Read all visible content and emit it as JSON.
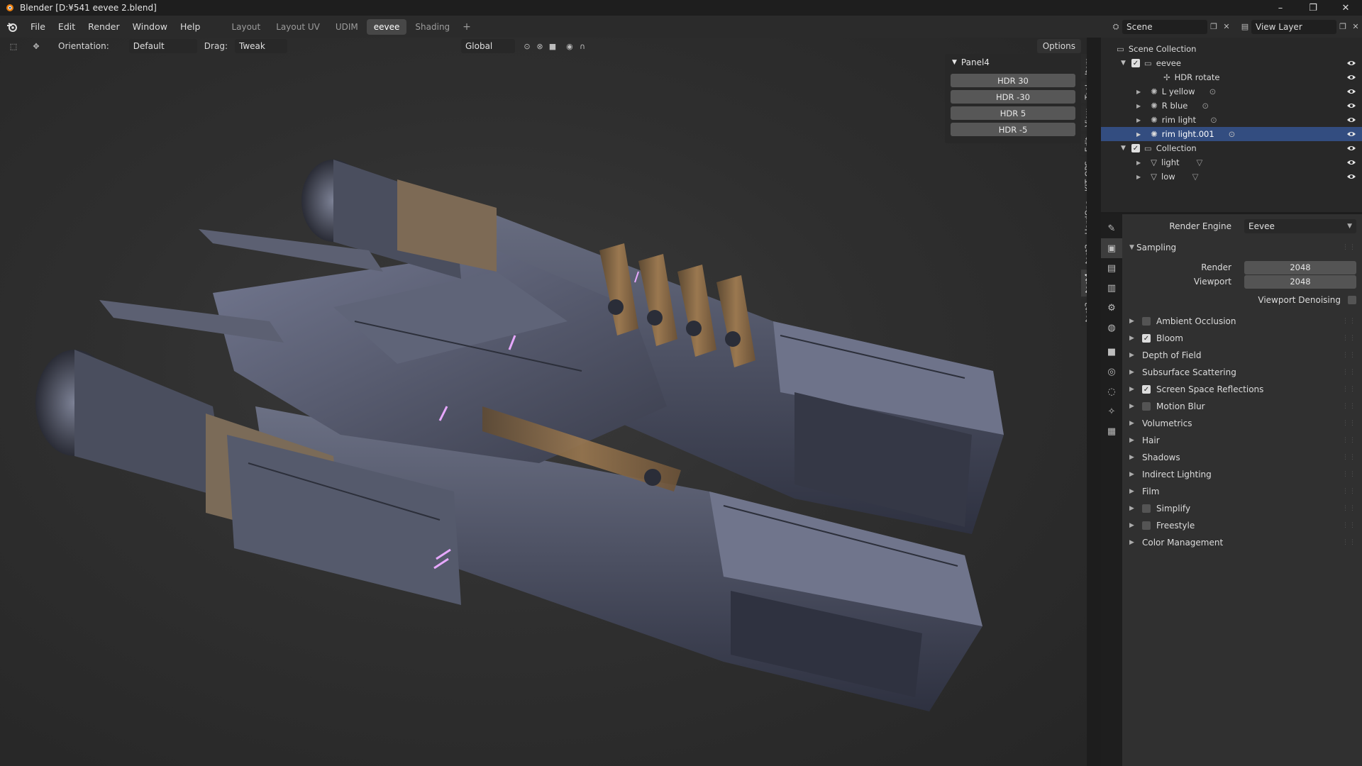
{
  "window": {
    "title": "Blender [D:¥541 eevee 2.blend]",
    "controls": [
      "–",
      "❐",
      "✕"
    ]
  },
  "menu": {
    "items": [
      "File",
      "Edit",
      "Render",
      "Window",
      "Help"
    ],
    "workspaces": [
      "Layout",
      "Layout UV",
      "UDIM",
      "eevee",
      "Shading"
    ],
    "active_workspace": "eevee",
    "add_label": "+",
    "scene_name": "Scene",
    "view_layer": "View Layer"
  },
  "viewport_header": {
    "orientation_label": "Orientation:",
    "orientation_value": "Default",
    "drag_label": "Drag:",
    "drag_value": "Tweak",
    "transform_space": "Global",
    "options_label": "Options"
  },
  "npanel": {
    "title": "Panel4",
    "buttons": [
      "HDR 30",
      "HDR -30",
      "HDR 5",
      "HDR -5"
    ],
    "tabs": [
      "Item",
      "Tool",
      "View",
      "Edit",
      "KIT OPS",
      "HardOps",
      "test2",
      "test4",
      "test3"
    ],
    "active_tab": "test4"
  },
  "outliner": {
    "root": "Scene Collection",
    "rows": [
      {
        "label": "eevee",
        "indent": 1,
        "type": "collection",
        "checked": true,
        "expanded": true
      },
      {
        "label": "HDR rotate",
        "indent": 2,
        "type": "empty"
      },
      {
        "label": "L yellow",
        "indent": 2,
        "type": "light"
      },
      {
        "label": "R blue",
        "indent": 2,
        "type": "light"
      },
      {
        "label": "rim light",
        "indent": 2,
        "type": "light"
      },
      {
        "label": "rim light.001",
        "indent": 2,
        "type": "light",
        "selected": true
      },
      {
        "label": "Collection",
        "indent": 1,
        "type": "collection",
        "checked": true,
        "expanded": true
      },
      {
        "label": "light",
        "indent": 2,
        "type": "mesh"
      },
      {
        "label": "low",
        "indent": 2,
        "type": "mesh"
      }
    ]
  },
  "properties": {
    "render_engine_label": "Render Engine",
    "render_engine_value": "Eevee",
    "sampling": {
      "title": "Sampling",
      "render_label": "Render",
      "render_value": "2048",
      "viewport_label": "Viewport",
      "viewport_value": "2048",
      "denoise_label": "Viewport Denoising"
    },
    "sections": [
      {
        "label": "Ambient Occlusion",
        "checkbox": true,
        "checked": false
      },
      {
        "label": "Bloom",
        "checkbox": true,
        "checked": true
      },
      {
        "label": "Depth of Field",
        "checkbox": false
      },
      {
        "label": "Subsurface Scattering",
        "checkbox": false
      },
      {
        "label": "Screen Space Reflections",
        "checkbox": true,
        "checked": true
      },
      {
        "label": "Motion Blur",
        "checkbox": true,
        "checked": false
      },
      {
        "label": "Volumetrics",
        "checkbox": false
      },
      {
        "label": "Hair",
        "checkbox": false
      },
      {
        "label": "Shadows",
        "checkbox": false
      },
      {
        "label": "Indirect Lighting",
        "checkbox": false
      },
      {
        "label": "Film",
        "checkbox": false
      },
      {
        "label": "Simplify",
        "checkbox": true,
        "checked": false
      },
      {
        "label": "Freestyle",
        "checkbox": true,
        "checked": false
      },
      {
        "label": "Color Management",
        "checkbox": false
      }
    ]
  },
  "colors": {
    "selection": "#334d80",
    "accent_glow": "#e7a8ff",
    "hull": "#5a5f73",
    "brass": "#8a6a45"
  }
}
